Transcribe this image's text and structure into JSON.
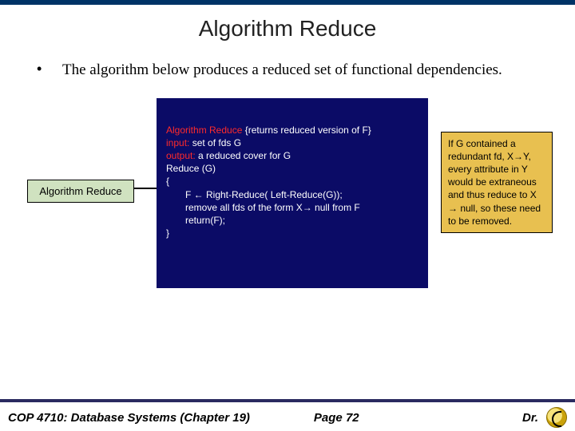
{
  "title": "Algorithm Reduce",
  "bullet": "The algorithm below produces a reduced set of functional dependencies.",
  "labelBox": "Algorithm Reduce",
  "code": {
    "l1a": "Algorithm Reduce",
    "l1b": "  {returns reduced version of F}",
    "l2a": "input:",
    "l2b": "  set of fds G",
    "l3a": "output:",
    "l3b": " a reduced cover for G",
    "l4": "Reduce (G)",
    "l5": "{",
    "l6": "F ← Right-Reduce( Left-Reduce(G));",
    "l7": "remove all fds of the form X→ null from F",
    "l8": "return(F);",
    "l9": "}"
  },
  "note": "If G contained a redundant fd, X→Y, every attribute in Y would be extraneous and thus reduce to X → null, so these need to be removed.",
  "footer": {
    "course": "COP 4710: Database Systems  (Chapter 19)",
    "page": "Page 72",
    "author": "Dr."
  }
}
